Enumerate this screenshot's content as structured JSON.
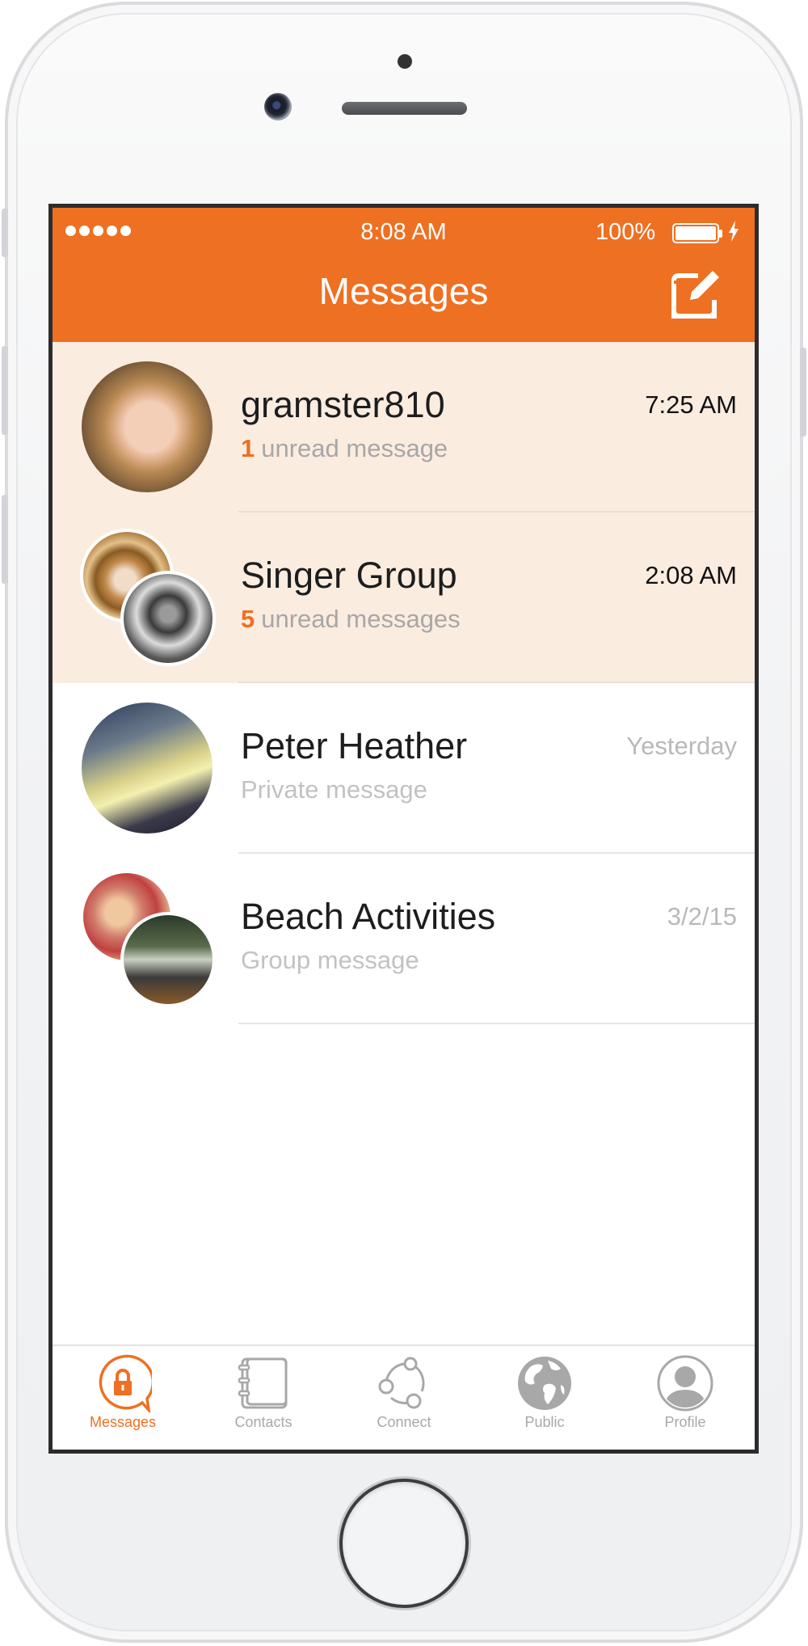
{
  "status_bar": {
    "time": "8:08 AM",
    "battery_percent": "100%",
    "signal_dots": 5
  },
  "nav": {
    "title": "Messages",
    "compose_icon": "compose-icon"
  },
  "conversations": [
    {
      "name": "gramster810",
      "time": "7:25 AM",
      "unread_count": "1",
      "preview": "unread message",
      "unread": true,
      "avatar": "single"
    },
    {
      "name": "Singer Group",
      "time": "2:08 AM",
      "unread_count": "5",
      "preview": "unread messages",
      "unread": true,
      "avatar": "group"
    },
    {
      "name": "Peter Heather",
      "time": "Yesterday",
      "preview": "Private message",
      "unread": false,
      "avatar": "single"
    },
    {
      "name": "Beach Activities",
      "time": "3/2/15",
      "preview": "Group message",
      "unread": false,
      "avatar": "group"
    }
  ],
  "tabs": [
    {
      "label": "Messages",
      "icon": "lock-chat-icon",
      "active": true
    },
    {
      "label": "Contacts",
      "icon": "address-book-icon",
      "active": false
    },
    {
      "label": "Connect",
      "icon": "connect-nodes-icon",
      "active": false
    },
    {
      "label": "Public",
      "icon": "globe-icon",
      "active": false
    },
    {
      "label": "Profile",
      "icon": "person-icon",
      "active": false
    }
  ],
  "colors": {
    "accent": "#ee7022",
    "unread_row": "#fbece0",
    "tab_inactive": "#a8a8a8"
  }
}
